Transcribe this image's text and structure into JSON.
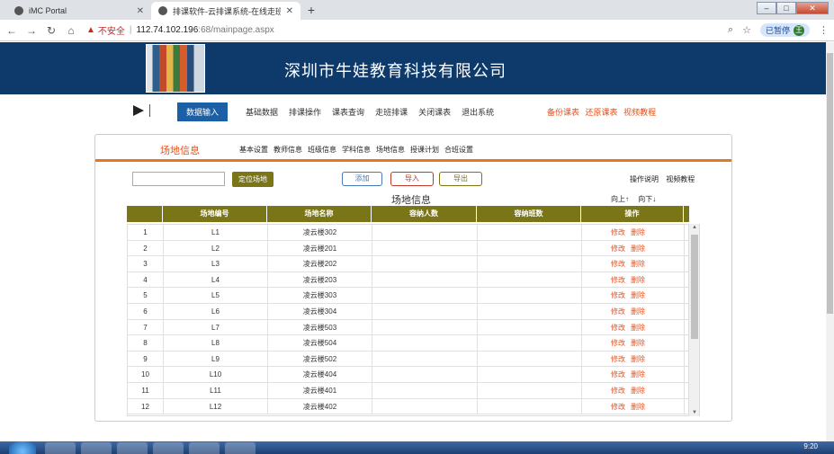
{
  "browser": {
    "tabs": [
      {
        "title": "iMC Portal",
        "active": false
      },
      {
        "title": "排课软件-云排课系统-在线走班排",
        "active": true
      }
    ],
    "address": {
      "warning": "不安全",
      "host": "112.74.102.196",
      "path": ":68/mainpage.aspx"
    },
    "paused_label": "已暂停",
    "profile_initial": "王"
  },
  "site": {
    "company_name": "深圳市牛娃教育科技有限公司",
    "menu": [
      "数据输入",
      "基础数据",
      "排课操作",
      "课表查询",
      "走班排课",
      "关闭课表",
      "退出系统"
    ],
    "menu_extra": [
      "备份课表",
      "还原课表",
      "视频教程"
    ]
  },
  "panel": {
    "title": "场地信息",
    "subnav": [
      "基本设置",
      "教师信息",
      "班级信息",
      "学科信息",
      "场地信息",
      "授课计划",
      "合班设置"
    ],
    "locate_input_value": "",
    "locate_button": "定位场地",
    "add_button": "添加",
    "import_button": "导入",
    "export_button": "导出",
    "help_links": [
      "操作说明",
      "视频教程"
    ],
    "table_title": "场地信息",
    "move_up": "向上↑",
    "move_down": "向下↓"
  },
  "table": {
    "headers": [
      "",
      "场地编号",
      "场地名称",
      "容纳人数",
      "容纳班数",
      "操作"
    ],
    "action_edit": "修改",
    "action_delete": "删除",
    "rows": [
      {
        "n": "1",
        "code": "L1",
        "name": "凌云楼302",
        "capacity": "",
        "classes": ""
      },
      {
        "n": "2",
        "code": "L2",
        "name": "凌云楼201",
        "capacity": "",
        "classes": ""
      },
      {
        "n": "3",
        "code": "L3",
        "name": "凌云楼202",
        "capacity": "",
        "classes": ""
      },
      {
        "n": "4",
        "code": "L4",
        "name": "凌云楼203",
        "capacity": "",
        "classes": ""
      },
      {
        "n": "5",
        "code": "L5",
        "name": "凌云楼303",
        "capacity": "",
        "classes": ""
      },
      {
        "n": "6",
        "code": "L6",
        "name": "凌云楼304",
        "capacity": "",
        "classes": ""
      },
      {
        "n": "7",
        "code": "L7",
        "name": "凌云楼503",
        "capacity": "",
        "classes": ""
      },
      {
        "n": "8",
        "code": "L8",
        "name": "凌云楼504",
        "capacity": "",
        "classes": ""
      },
      {
        "n": "9",
        "code": "L9",
        "name": "凌云楼502",
        "capacity": "",
        "classes": ""
      },
      {
        "n": "10",
        "code": "L10",
        "name": "凌云楼404",
        "capacity": "",
        "classes": ""
      },
      {
        "n": "11",
        "code": "L11",
        "name": "凌云楼401",
        "capacity": "",
        "classes": ""
      },
      {
        "n": "12",
        "code": "L12",
        "name": "凌云楼402",
        "capacity": "",
        "classes": ""
      }
    ]
  },
  "taskbar": {
    "clock": "9:20"
  }
}
